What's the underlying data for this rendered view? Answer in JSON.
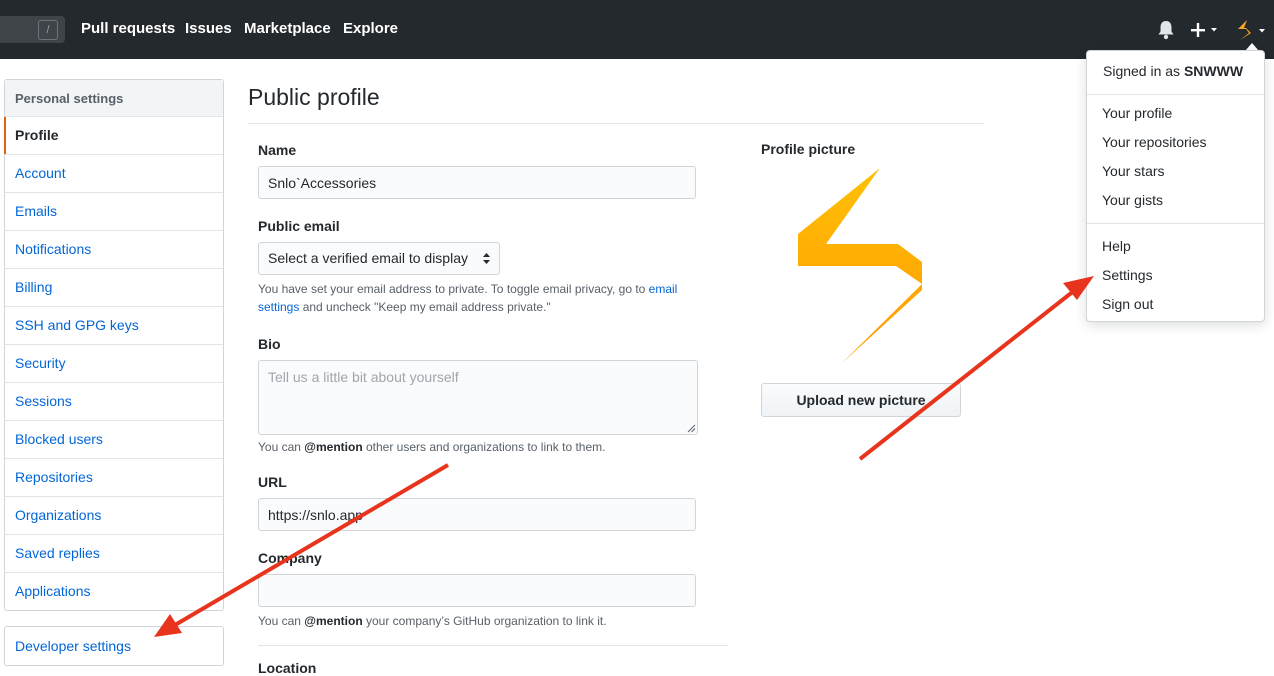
{
  "header": {
    "search_shortcut": "/",
    "nav": [
      "Pull requests",
      "Issues",
      "Marketplace",
      "Explore"
    ],
    "icons": [
      "bell-icon",
      "plus-icon",
      "avatar-bolt-icon",
      "caret-down-icon"
    ],
    "bg_color": "#24292e"
  },
  "sidebar": {
    "heading": "Personal settings",
    "items": [
      {
        "label": "Profile",
        "selected": true
      },
      {
        "label": "Account"
      },
      {
        "label": "Emails"
      },
      {
        "label": "Notifications"
      },
      {
        "label": "Billing"
      },
      {
        "label": "SSH and GPG keys"
      },
      {
        "label": "Security"
      },
      {
        "label": "Sessions"
      },
      {
        "label": "Blocked users"
      },
      {
        "label": "Repositories"
      },
      {
        "label": "Organizations"
      },
      {
        "label": "Saved replies"
      },
      {
        "label": "Applications"
      }
    ],
    "developer_settings": "Developer settings"
  },
  "main": {
    "title": "Public profile",
    "name": {
      "label": "Name",
      "value": "Snlo`Accessories"
    },
    "public_email": {
      "label": "Public email",
      "selected": "Select a verified email to display",
      "note_prefix": "You have set your email address to private. To toggle email privacy, go to",
      "note_link1": "email",
      "note_link2": "settings",
      "note_suffix": "and uncheck \"Keep my email address private.\""
    },
    "bio": {
      "label": "Bio",
      "placeholder": "Tell us a little bit about yourself",
      "note_prefix": "You can",
      "note_mention": "@mention",
      "note_suffix": "other users and organizations to link to them."
    },
    "url": {
      "label": "URL",
      "value": "https://snlo.app"
    },
    "company": {
      "label": "Company",
      "value": "",
      "note_prefix": "You can",
      "note_mention": "@mention",
      "note_suffix": "your company’s GitHub organization to link it."
    },
    "next_label_partial": "Location"
  },
  "profile_picture": {
    "label": "Profile picture",
    "upload_button": "Upload new picture",
    "icon": "lightning-bolt-icon",
    "colors": [
      "#ffc107",
      "#ff9800"
    ]
  },
  "user_menu": {
    "signed_in_prefix": "Signed in as",
    "username": "SNWWW",
    "group1": [
      "Your profile",
      "Your repositories",
      "Your stars",
      "Your gists"
    ],
    "group2": [
      "Help",
      "Settings",
      "Sign out"
    ]
  },
  "annotations": {
    "arrow_color": "#e8341c"
  }
}
